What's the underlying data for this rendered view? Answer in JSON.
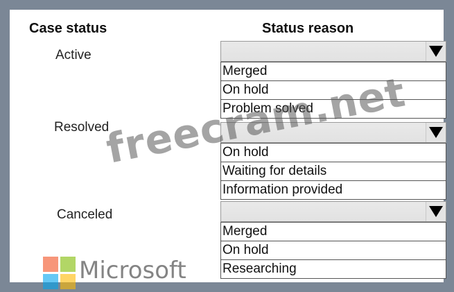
{
  "headers": {
    "case_status": "Case status",
    "status_reason": "Status reason"
  },
  "rows": [
    {
      "case_status": "Active",
      "options": [
        "Merged",
        "On hold",
        "Problem solved"
      ]
    },
    {
      "case_status": "Resolved",
      "options": [
        "On hold",
        "Waiting for details",
        "Information provided"
      ]
    },
    {
      "case_status": "Canceled",
      "options": [
        "Merged",
        "On hold",
        "Researching"
      ]
    }
  ],
  "watermark": "freecram.net",
  "brand": {
    "name": "Microsoft",
    "logo_colors": [
      "#f25022",
      "#7fba00",
      "#00a4ef",
      "#ffb900"
    ],
    "icon": "microsoft-logo-icon"
  },
  "dropdown_icon": "triangle-down-icon"
}
